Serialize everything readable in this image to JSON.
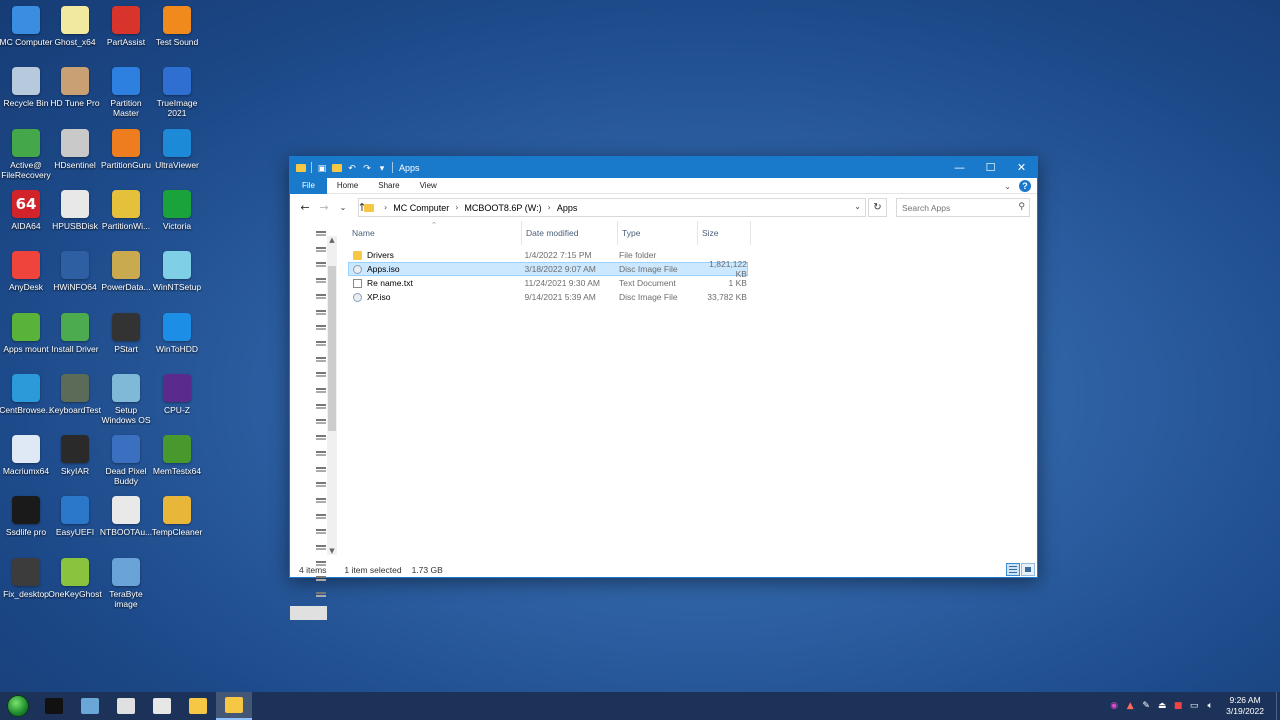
{
  "desktop_icons": [
    {
      "label": "MC Computer",
      "icon": "computer-icon",
      "color": "#3a8de0"
    },
    {
      "label": "Ghost_x64",
      "icon": "ghost-icon",
      "color": "#f2e9a0"
    },
    {
      "label": "PartAssist",
      "icon": "partition-assistant-icon",
      "color": "#d8342c"
    },
    {
      "label": "Test Sound",
      "icon": "vlc-cone-icon",
      "color": "#f08a1c"
    },
    {
      "label": "Recycle Bin",
      "icon": "recycle-bin-icon",
      "color": "#b7c9dc"
    },
    {
      "label": "HD Tune Pro",
      "icon": "hd-tune-icon",
      "color": "#c9a074"
    },
    {
      "label": "Partition Master",
      "icon": "partition-master-icon",
      "color": "#2d7fe0"
    },
    {
      "label": "TrueImage 2021",
      "icon": "acronis-icon",
      "color": "#2e6fd1"
    },
    {
      "label": "Active@ FileRecovery",
      "icon": "file-recovery-icon",
      "color": "#44a84a"
    },
    {
      "label": "HDsentinel",
      "icon": "hdsentinel-icon",
      "color": "#c9c9c9"
    },
    {
      "label": "PartitionGuru",
      "icon": "partition-guru-icon",
      "color": "#ee7d1f"
    },
    {
      "label": "UltraViewer",
      "icon": "ultraviewer-icon",
      "color": "#1d8ad8"
    },
    {
      "label": "AIDA64",
      "icon": "aida64-icon",
      "color": "#d2232a",
      "text": "64"
    },
    {
      "label": "HPUSBDisk",
      "icon": "usb-disk-icon",
      "color": "#e8e8e8"
    },
    {
      "label": "PartitionWi...",
      "icon": "partition-wizard-icon",
      "color": "#e5c03a"
    },
    {
      "label": "Victoria",
      "icon": "victoria-cross-icon",
      "color": "#19a33a"
    },
    {
      "label": "AnyDesk",
      "icon": "anydesk-icon",
      "color": "#ef443b"
    },
    {
      "label": "HWiNFO64",
      "icon": "hwinfo-icon",
      "color": "#2e5fa3"
    },
    {
      "label": "PowerData...",
      "icon": "powerdata-icon",
      "color": "#c9aa4e"
    },
    {
      "label": "WinNTSetup",
      "icon": "winntsetup-icon",
      "color": "#7fd0e6"
    },
    {
      "label": "Apps mount",
      "icon": "apps-mount-icon",
      "color": "#59b23a"
    },
    {
      "label": "Install Driver",
      "icon": "install-driver-icon",
      "color": "#4bab4e"
    },
    {
      "label": "PStart",
      "icon": "pstart-play-icon",
      "color": "#333333"
    },
    {
      "label": "WinToHDD",
      "icon": "wintohdd-icon",
      "color": "#1d8ee6"
    },
    {
      "label": "CentBrowse...",
      "icon": "centbrowser-icon",
      "color": "#2c9ad8"
    },
    {
      "label": "KeyboardTest",
      "icon": "keyboard-test-icon",
      "color": "#5b6b58"
    },
    {
      "label": "Setup Windows OS",
      "icon": "setup-windows-icon",
      "color": "#7fb9d8"
    },
    {
      "label": "CPU-Z",
      "icon": "cpu-z-icon",
      "color": "#5a2b8c"
    },
    {
      "label": "Macriumx64",
      "icon": "macrium-icon",
      "color": "#dfe9f5"
    },
    {
      "label": "SkyIAR",
      "icon": "skyiar-icon",
      "color": "#2a2a2a"
    },
    {
      "label": "Dead Pixel Buddy",
      "icon": "dead-pixel-icon",
      "color": "#3b6fbf"
    },
    {
      "label": "MemTestx64",
      "icon": "memtest-icon",
      "color": "#47992e"
    },
    {
      "label": "Ssdlife pro",
      "icon": "ssdlife-icon",
      "color": "#1a1a1a"
    },
    {
      "label": "EasyUEFI",
      "icon": "easyuefi-icon",
      "color": "#2b77c9"
    },
    {
      "label": "NTBOOTAu...",
      "icon": "ntbootautofix-icon",
      "color": "#e9e9e9"
    },
    {
      "label": "TempCleaner",
      "icon": "broom-icon",
      "color": "#e8b73a"
    },
    {
      "label": "Fix_desktop",
      "icon": "fix-desktop-icon",
      "color": "#3c3c3c"
    },
    {
      "label": "OneKeyGhost",
      "icon": "onekeyghost-icon",
      "color": "#8ac43f"
    },
    {
      "label": "TeraByte image",
      "icon": "terabyte-image-icon",
      "color": "#6aa3d8"
    }
  ],
  "window": {
    "title": "Apps",
    "minimize": "—",
    "maximize": "☐",
    "close": "✕",
    "ribbon_tabs": [
      "File",
      "Home",
      "Share",
      "View"
    ],
    "help": "?",
    "address": {
      "crumbs": [
        "MC Computer",
        "MCBOOT8.6P (W:)",
        "Apps"
      ]
    },
    "search": {
      "placeholder": "Search Apps"
    },
    "columns": [
      "Name",
      "Date modified",
      "Type",
      "Size"
    ],
    "files": [
      {
        "name": "Drivers",
        "date": "1/4/2022 7:15 PM",
        "type": "File folder",
        "size": "",
        "icon": "folder-icon",
        "kind": "folder",
        "selected": false
      },
      {
        "name": "Apps.iso",
        "date": "3/18/2022 9:07 AM",
        "type": "Disc Image File",
        "size": "1,821,122 KB",
        "icon": "disc-image-icon",
        "kind": "iso",
        "selected": true
      },
      {
        "name": "Re name.txt",
        "date": "11/24/2021 9:30 AM",
        "type": "Text Document",
        "size": "1 KB",
        "icon": "text-file-icon",
        "kind": "txt",
        "selected": false
      },
      {
        "name": "XP.iso",
        "date": "9/14/2021 5:39 AM",
        "type": "Disc Image File",
        "size": "33,782 KB",
        "icon": "disc-image-icon",
        "kind": "iso",
        "selected": false
      }
    ],
    "status": {
      "count": "4 items",
      "selection": "1 item selected",
      "size": "1.73 GB"
    }
  },
  "taskbar": {
    "items": [
      {
        "name": "cmd-icon",
        "color": "#111111",
        "active": false
      },
      {
        "name": "remote-monitor-icon",
        "color": "#6aa6d8",
        "active": false
      },
      {
        "name": "diamond-tool-icon",
        "color": "#e0e0e0",
        "active": false
      },
      {
        "name": "windows-app-icon",
        "color": "#e7e7e7",
        "active": false
      },
      {
        "name": "file-explorer-icon",
        "color": "#f5c745",
        "active": false
      },
      {
        "name": "file-explorer-active-icon",
        "color": "#f5c745",
        "active": true
      }
    ],
    "clock": {
      "time": "9:26 AM",
      "date": "3/19/2022"
    }
  }
}
